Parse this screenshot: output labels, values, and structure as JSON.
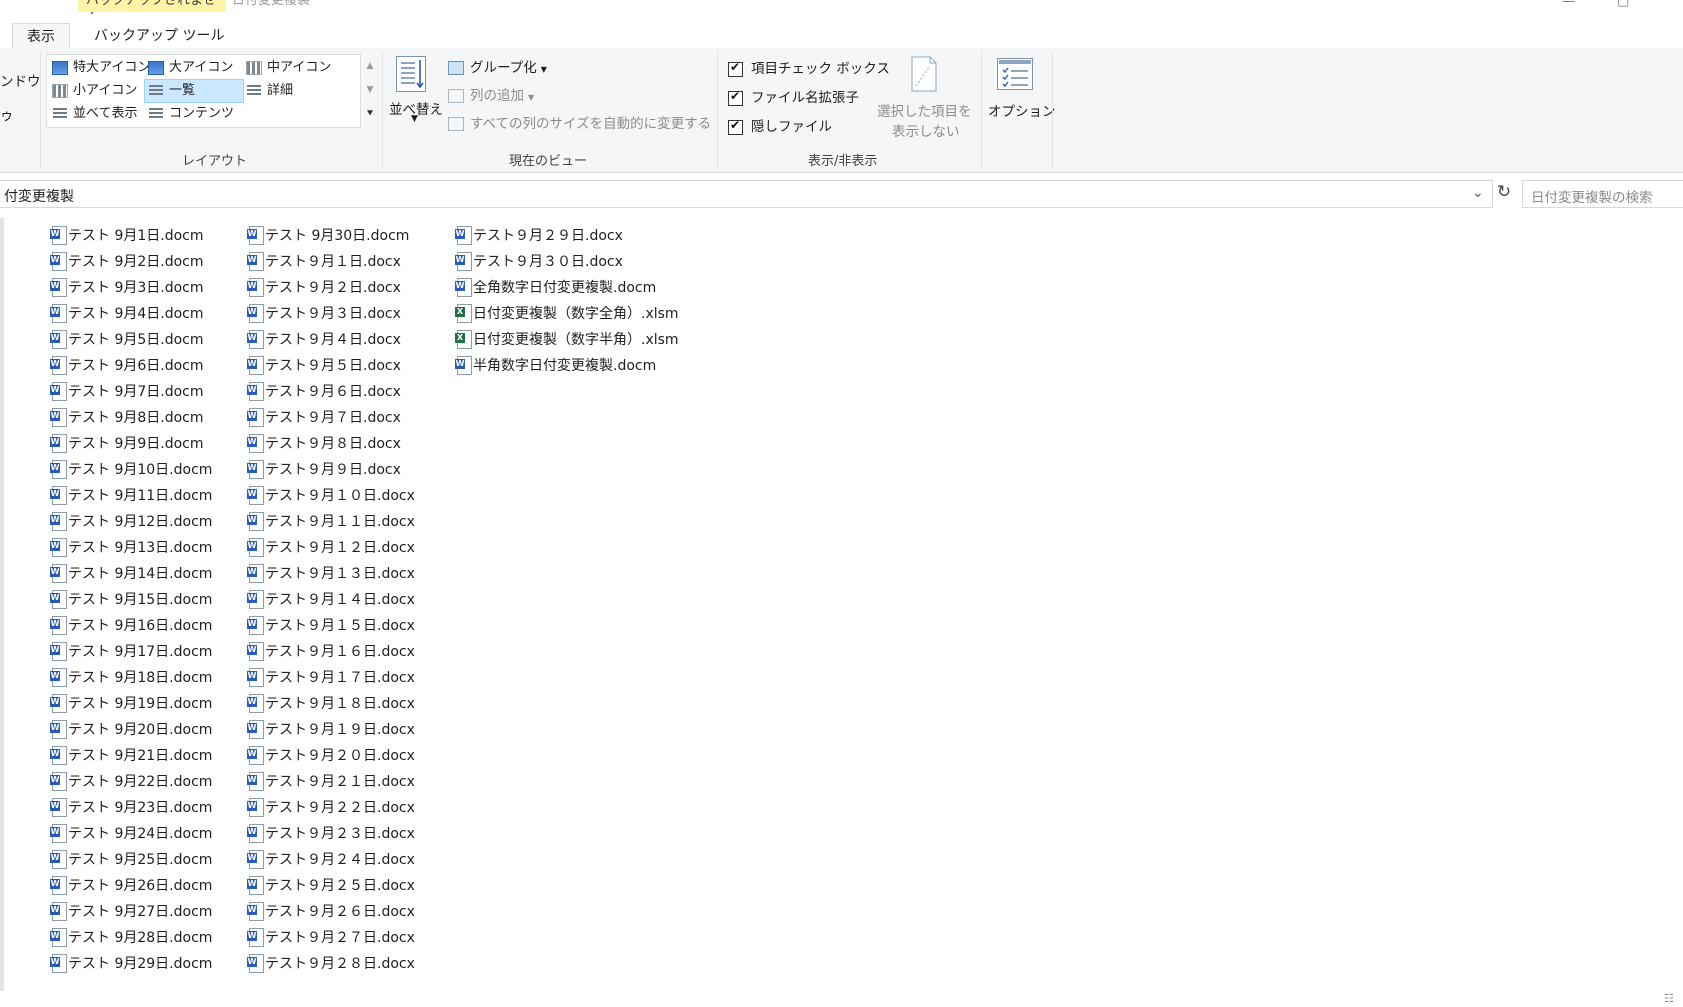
{
  "titlebar": {
    "context_tab": "バックアップされません",
    "title": "日付変更複製",
    "minimize": "—",
    "maximize": "▢"
  },
  "tabs": {
    "view": "表示",
    "backup_tools": "バックアップ ツール"
  },
  "ribbon": {
    "left_cut_1": "ンドウ",
    "left_cut_2": "ゥ",
    "layout": {
      "items": [
        "特大アイコン",
        "大アイコン",
        "中アイコン",
        "小アイコン",
        "一覧",
        "詳細",
        "並べて表示",
        "コンテンツ"
      ],
      "selected": "一覧",
      "label": "レイアウト"
    },
    "current_view": {
      "sort": "並べ替え",
      "group_by": "グループ化",
      "add_column": "列の追加",
      "size_all": "すべての列のサイズを自動的に変更する",
      "label": "現在のビュー"
    },
    "show_hide": {
      "item_checkboxes": "項目チェック ボックス",
      "file_extensions": "ファイル名拡張子",
      "hidden_items": "隠しファイル",
      "hide_selected_1": "選択した項目を",
      "hide_selected_2": "表示しない",
      "label": "表示/非表示"
    },
    "options": "オプション"
  },
  "address": {
    "path": "付変更複製",
    "search_placeholder": "日付変更複製の検索"
  },
  "columns": [
    [
      {
        "name": "テスト 9月1日.docm",
        "type": "w"
      },
      {
        "name": "テスト 9月2日.docm",
        "type": "w"
      },
      {
        "name": "テスト 9月3日.docm",
        "type": "w"
      },
      {
        "name": "テスト 9月4日.docm",
        "type": "w"
      },
      {
        "name": "テスト 9月5日.docm",
        "type": "w"
      },
      {
        "name": "テスト 9月6日.docm",
        "type": "w"
      },
      {
        "name": "テスト 9月7日.docm",
        "type": "w"
      },
      {
        "name": "テスト 9月8日.docm",
        "type": "w"
      },
      {
        "name": "テスト 9月9日.docm",
        "type": "w"
      },
      {
        "name": "テスト 9月10日.docm",
        "type": "w"
      },
      {
        "name": "テスト 9月11日.docm",
        "type": "w"
      },
      {
        "name": "テスト 9月12日.docm",
        "type": "w"
      },
      {
        "name": "テスト 9月13日.docm",
        "type": "w"
      },
      {
        "name": "テスト 9月14日.docm",
        "type": "w"
      },
      {
        "name": "テスト 9月15日.docm",
        "type": "w"
      },
      {
        "name": "テスト 9月16日.docm",
        "type": "w"
      },
      {
        "name": "テスト 9月17日.docm",
        "type": "w"
      },
      {
        "name": "テスト 9月18日.docm",
        "type": "w"
      },
      {
        "name": "テスト 9月19日.docm",
        "type": "w"
      },
      {
        "name": "テスト 9月20日.docm",
        "type": "w"
      },
      {
        "name": "テスト 9月21日.docm",
        "type": "w"
      },
      {
        "name": "テスト 9月22日.docm",
        "type": "w"
      },
      {
        "name": "テスト 9月23日.docm",
        "type": "w"
      },
      {
        "name": "テスト 9月24日.docm",
        "type": "w"
      },
      {
        "name": "テスト 9月25日.docm",
        "type": "w"
      },
      {
        "name": "テスト 9月26日.docm",
        "type": "w"
      },
      {
        "name": "テスト 9月27日.docm",
        "type": "w"
      },
      {
        "name": "テスト 9月28日.docm",
        "type": "w"
      },
      {
        "name": "テスト 9月29日.docm",
        "type": "w"
      }
    ],
    [
      {
        "name": "テスト 9月30日.docm",
        "type": "w"
      },
      {
        "name": "テスト９月１日.docx",
        "type": "w"
      },
      {
        "name": "テスト９月２日.docx",
        "type": "w"
      },
      {
        "name": "テスト９月３日.docx",
        "type": "w"
      },
      {
        "name": "テスト９月４日.docx",
        "type": "w"
      },
      {
        "name": "テスト９月５日.docx",
        "type": "w"
      },
      {
        "name": "テスト９月６日.docx",
        "type": "w"
      },
      {
        "name": "テスト９月７日.docx",
        "type": "w"
      },
      {
        "name": "テスト９月８日.docx",
        "type": "w"
      },
      {
        "name": "テスト９月９日.docx",
        "type": "w"
      },
      {
        "name": "テスト９月１０日.docx",
        "type": "w"
      },
      {
        "name": "テスト９月１１日.docx",
        "type": "w"
      },
      {
        "name": "テスト９月１２日.docx",
        "type": "w"
      },
      {
        "name": "テスト９月１３日.docx",
        "type": "w"
      },
      {
        "name": "テスト９月１４日.docx",
        "type": "w"
      },
      {
        "name": "テスト９月１５日.docx",
        "type": "w"
      },
      {
        "name": "テスト９月１６日.docx",
        "type": "w"
      },
      {
        "name": "テスト９月１７日.docx",
        "type": "w"
      },
      {
        "name": "テスト９月１８日.docx",
        "type": "w"
      },
      {
        "name": "テスト９月１９日.docx",
        "type": "w"
      },
      {
        "name": "テスト９月２０日.docx",
        "type": "w"
      },
      {
        "name": "テスト９月２１日.docx",
        "type": "w"
      },
      {
        "name": "テスト９月２２日.docx",
        "type": "w"
      },
      {
        "name": "テスト９月２３日.docx",
        "type": "w"
      },
      {
        "name": "テスト９月２４日.docx",
        "type": "w"
      },
      {
        "name": "テスト９月２５日.docx",
        "type": "w"
      },
      {
        "name": "テスト９月２６日.docx",
        "type": "w"
      },
      {
        "name": "テスト９月２７日.docx",
        "type": "w"
      },
      {
        "name": "テスト９月２８日.docx",
        "type": "w"
      }
    ],
    [
      {
        "name": "テスト９月２９日.docx",
        "type": "w"
      },
      {
        "name": "テスト９月３０日.docx",
        "type": "w"
      },
      {
        "name": "全角数字日付変更複製.docm",
        "type": "w"
      },
      {
        "name": "日付変更複製（数字全角）.xlsm",
        "type": "x"
      },
      {
        "name": "日付変更複製（数字半角）.xlsm",
        "type": "x"
      },
      {
        "name": "半角数字日付変更複製.docm",
        "type": "w"
      }
    ]
  ],
  "icons": {
    "word_letter": "W",
    "excel_letter": "X",
    "word_color": "#2b5cb5",
    "excel_color": "#217346",
    "refresh": "↻",
    "dropdown": "⌄",
    "details_view": "☷"
  }
}
